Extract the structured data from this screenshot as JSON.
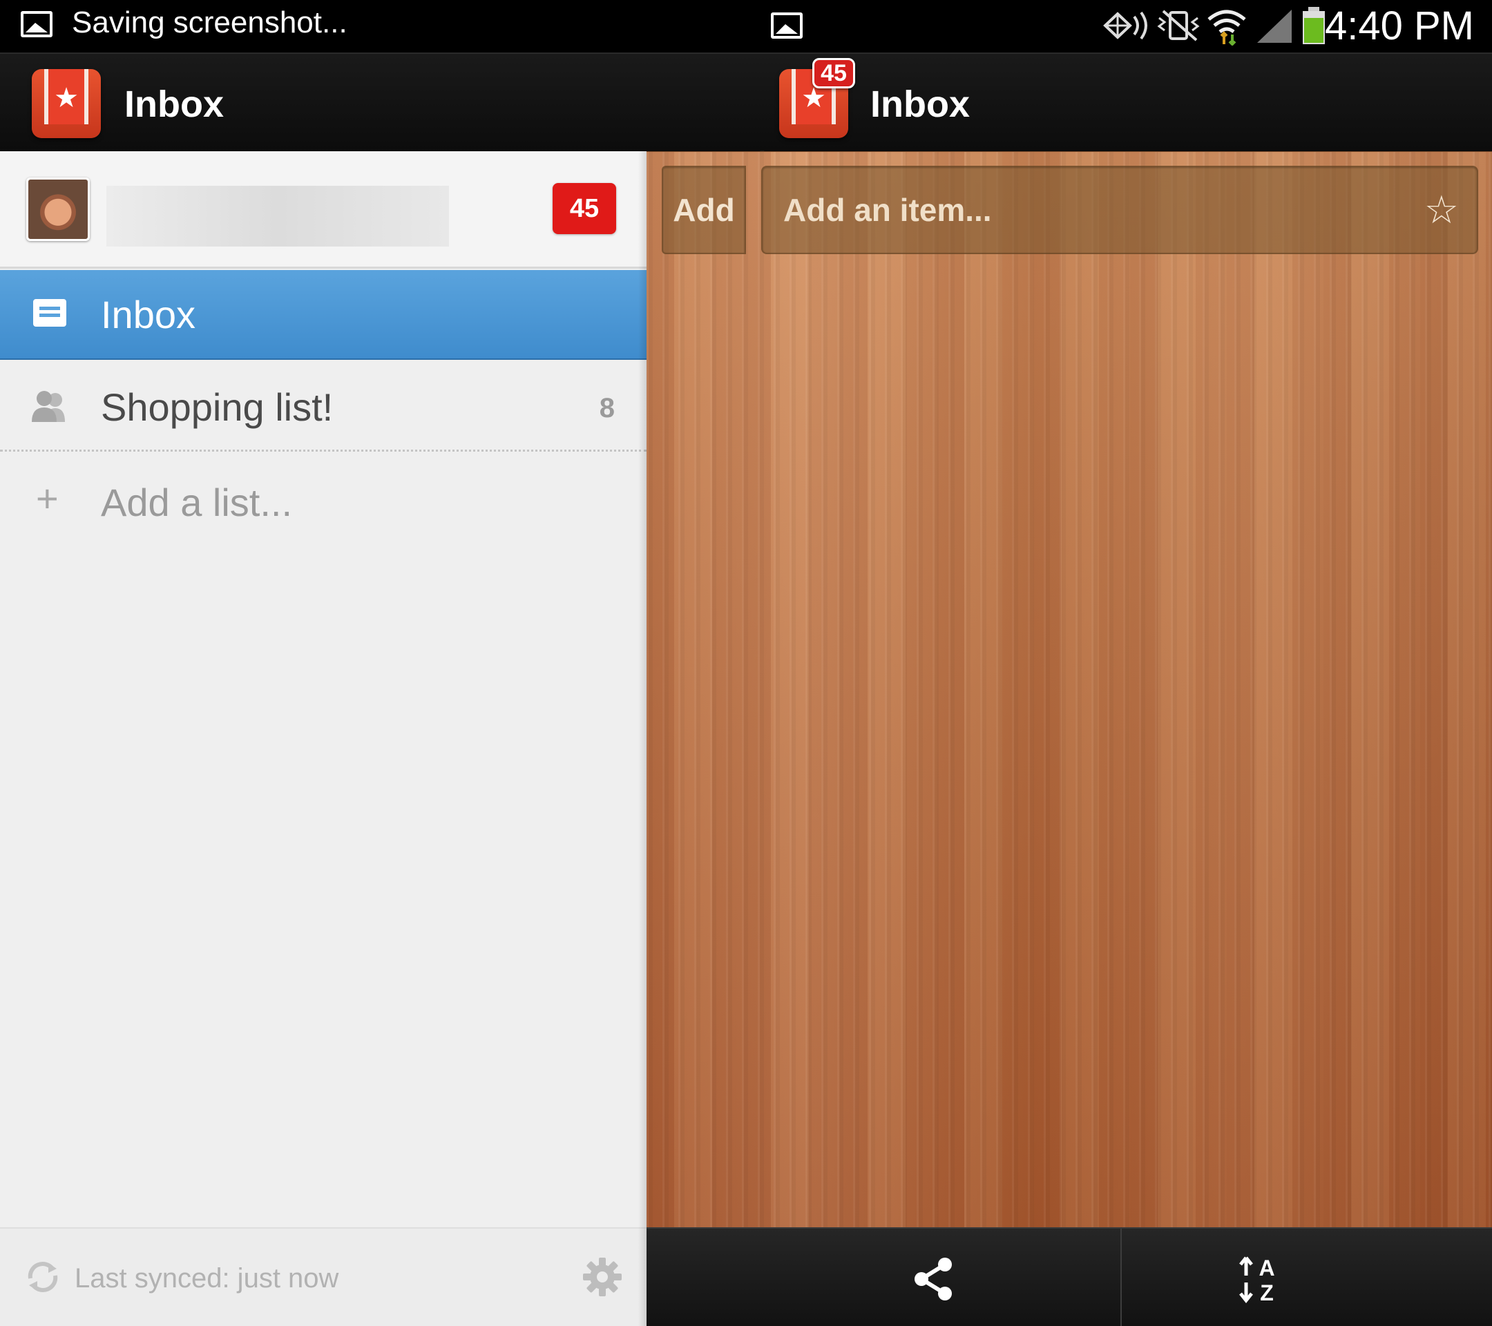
{
  "status_bar": {
    "notification_text": "Saving screenshot...",
    "time": "4:40 PM",
    "icons": [
      "gallery-icon",
      "gallery-icon",
      "nfc-icon",
      "vibrate-icon",
      "wifi-icon",
      "signal-icon",
      "battery-icon"
    ]
  },
  "header": {
    "left_title": "Inbox",
    "right_title": "Inbox",
    "badge_count": "45"
  },
  "sidebar": {
    "account_badge": "45",
    "account_name": "",
    "lists": [
      {
        "label": "Inbox",
        "count": "",
        "icon": "inbox-tray-icon",
        "selected": true
      },
      {
        "label": "Shopping list!",
        "count": "8",
        "icon": "shared-users-icon",
        "selected": false
      }
    ],
    "add_list_placeholder": "Add a list...",
    "add_list_plus": "+",
    "sync_status": "Last synced: just now"
  },
  "main": {
    "add_button_label": "Add",
    "add_item_placeholder": "Add an item...",
    "star_glyph": "☆"
  },
  "toolbar": {
    "buttons": [
      "share-icon",
      "sort-alpha-icon"
    ]
  },
  "colors": {
    "selected_row": "#4a97d5",
    "badge_red": "#e01a18",
    "wood": "#b86e42",
    "logo_red": "#e8532f"
  }
}
